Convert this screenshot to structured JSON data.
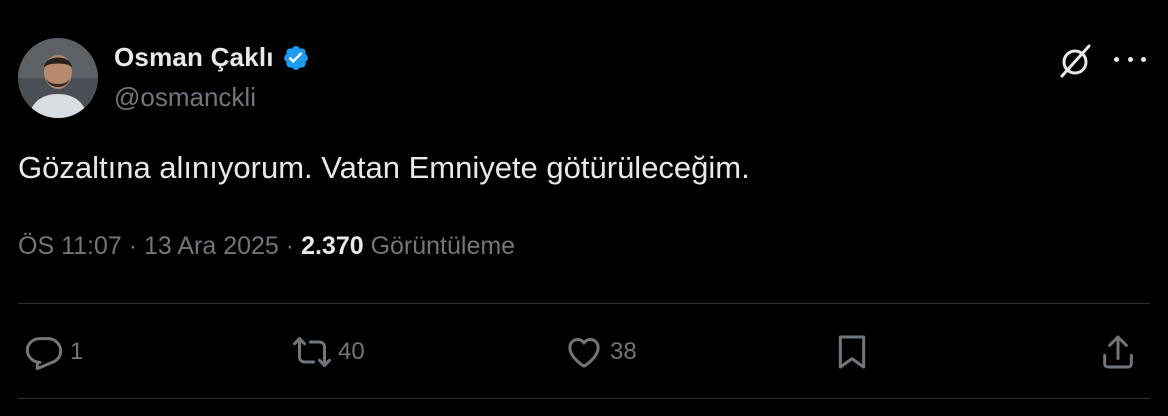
{
  "author": {
    "display_name": "Osman Çaklı",
    "handle": "@osmanckli",
    "verified_icon": "verified-badge-icon",
    "badge_color": "#1d9bf0"
  },
  "tweet": {
    "text": "Gözaltına alınıyorum. Vatan Emniyete götürüleceğim."
  },
  "meta": {
    "time": "ÖS 11:07",
    "sep1": " · ",
    "date": "13 Ara 2025",
    "sep2": " · ",
    "views_count": "2.370",
    "views_label": " Görüntüleme"
  },
  "actions": {
    "replies": "1",
    "reposts": "40",
    "likes": "38"
  },
  "colors": {
    "background": "#000000",
    "text": "#e7e9ea",
    "secondary": "#71767b",
    "divider": "#2f3336"
  }
}
